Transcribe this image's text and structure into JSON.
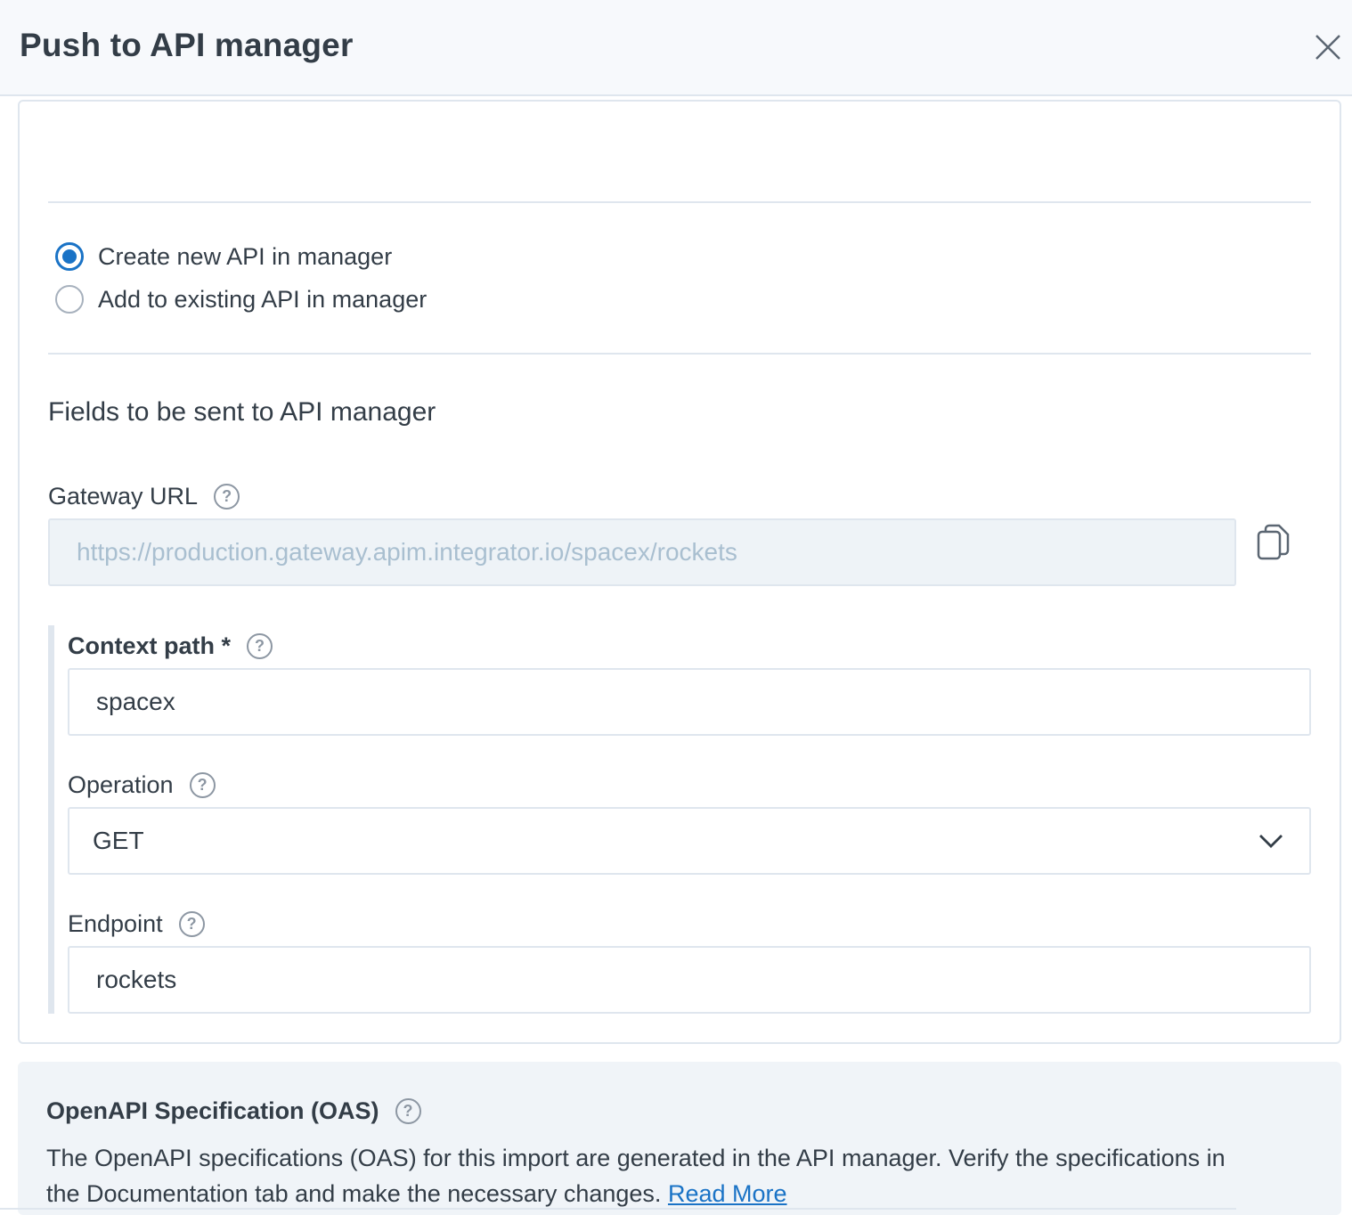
{
  "dialog": {
    "title": "Push to API manager"
  },
  "mode": {
    "options": [
      {
        "label": "Create new API in manager",
        "checked": true
      },
      {
        "label": "Add to existing API in manager",
        "checked": false
      }
    ]
  },
  "fields": {
    "heading": "Fields to be sent to API manager",
    "gateway_url": {
      "label": "Gateway URL",
      "value": "https://production.gateway.apim.integrator.io/spacex/rockets"
    },
    "context_path": {
      "label": "Context path *",
      "value": "spacex"
    },
    "operation": {
      "label": "Operation",
      "value": "GET"
    },
    "endpoint": {
      "label": "Endpoint",
      "value": "rockets"
    }
  },
  "oas": {
    "title": "OpenAPI Specification (OAS)",
    "description": "The OpenAPI specifications (OAS) for this import are generated in the API manager. Verify the specifications in the Documentation tab and make the necessary changes.",
    "link_label": "Read More"
  },
  "help_symbol": "?",
  "colors": {
    "accent": "#1a73c6",
    "text": "#333d47",
    "border": "#dfe6ee",
    "header_bg": "#f7f9fc",
    "disabled_bg": "#eef3f7",
    "info_bg": "#f0f4f8"
  }
}
